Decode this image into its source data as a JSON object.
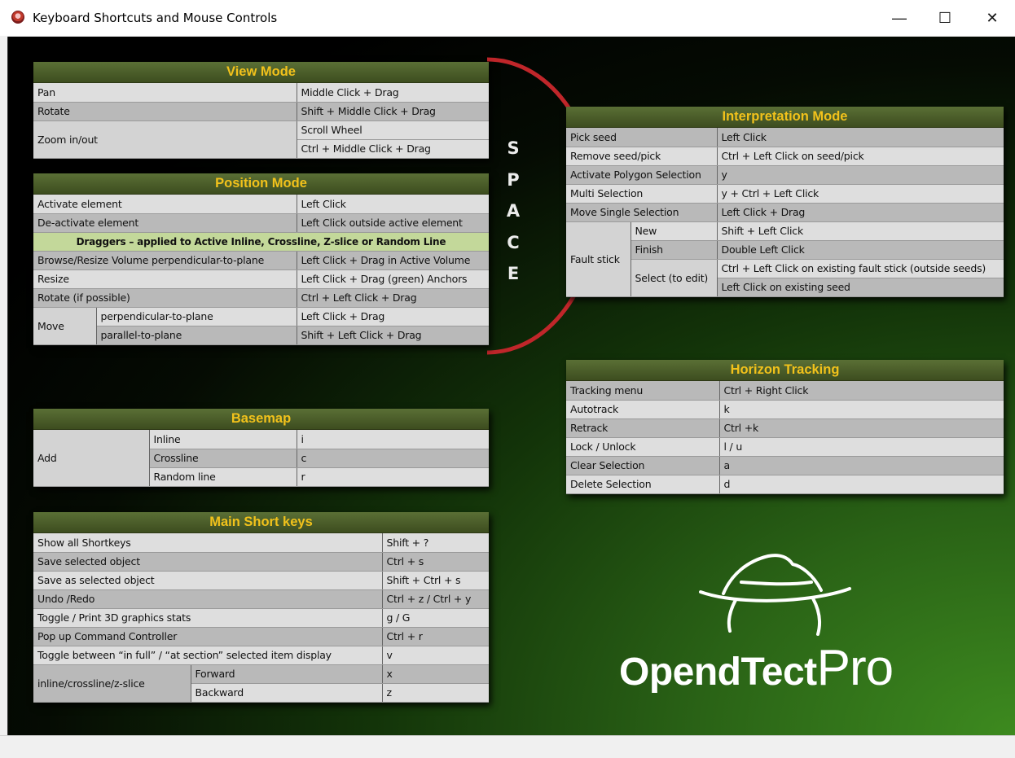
{
  "window": {
    "title": "Keyboard Shortcuts and Mouse Controls",
    "minimize_glyph": "—",
    "maximize_glyph": "☐",
    "close_glyph": "✕"
  },
  "space_label": [
    "S",
    "P",
    "A",
    "C",
    "E"
  ],
  "colors": {
    "header_text": "#f2c21b",
    "header_bg": "#4b5e28",
    "banner_bg": "#c3d89a",
    "arc": "#c0262a"
  },
  "view_mode": {
    "title": "View Mode",
    "rows": [
      {
        "action": "Pan",
        "control": "Middle Click + Drag"
      },
      {
        "action": "Rotate",
        "control": "Shift + Middle Click + Drag"
      },
      {
        "action": "Zoom in/out",
        "control": "Scroll Wheel"
      },
      {
        "control": "Ctrl + Middle Click + Drag"
      }
    ]
  },
  "position_mode": {
    "title": "Position Mode",
    "rows": [
      {
        "action": "Activate element",
        "control": "Left Click"
      },
      {
        "action": "De-activate element",
        "control": "Left Click outside active element"
      }
    ],
    "banner": "Draggers – applied to Active Inline, Crossline, Z-slice or Random Line",
    "dragger_rows": [
      {
        "action": "Browse/Resize Volume perpendicular-to-plane",
        "control": "Left Click + Drag in Active Volume"
      },
      {
        "action": "Resize",
        "control": "Left Click + Drag (green) Anchors"
      },
      {
        "action": "Rotate (if possible)",
        "control": "Ctrl  + Left Click + Drag"
      }
    ],
    "move": {
      "label": "Move",
      "rows": [
        {
          "sub": "perpendicular-to-plane",
          "control": "Left Click + Drag"
        },
        {
          "sub": "parallel-to-plane",
          "control": "Shift + Left Click + Drag"
        }
      ]
    }
  },
  "basemap": {
    "title": "Basemap",
    "add_label": "Add",
    "rows": [
      {
        "sub": "Inline",
        "key": "i"
      },
      {
        "sub": "Crossline",
        "key": "c"
      },
      {
        "sub": "Random line",
        "key": "r"
      }
    ]
  },
  "main_short_keys": {
    "title": "Main Short keys",
    "rows": [
      {
        "action": "Show all Shortkeys",
        "key": "Shift + ?"
      },
      {
        "action": "Save selected object",
        "key": "Ctrl + s"
      },
      {
        "action": "Save as selected object",
        "key": "Shift + Ctrl + s"
      },
      {
        "action": "Undo /Redo",
        "key": "Ctrl + z / Ctrl + y"
      },
      {
        "action": "Toggle / Print 3D graphics stats",
        "key": "g / G"
      },
      {
        "action": "Pop up Command Controller",
        "key": "Ctrl + r"
      },
      {
        "action": "Toggle between  “in full” / “at section” selected item display",
        "key": "v"
      }
    ],
    "slice": {
      "label": "inline/crossline/z-slice",
      "rows": [
        {
          "sub": "Forward",
          "key": "x"
        },
        {
          "sub": "Backward",
          "key": "z"
        }
      ]
    }
  },
  "interpretation_mode": {
    "title": "Interpretation Mode",
    "rows": [
      {
        "action": "Pick seed",
        "control": "Left Click"
      },
      {
        "action": "Remove seed/pick",
        "control": "Ctrl + Left Click on seed/pick"
      },
      {
        "action": "Activate Polygon Selection",
        "control": "y"
      },
      {
        "action": "Multi Selection",
        "control": "y + Ctrl + Left Click"
      },
      {
        "action": "Move Single Selection",
        "control": "Left Click + Drag"
      }
    ],
    "fault_stick": {
      "label": "Fault stick",
      "new": {
        "sub": "New",
        "control": "Shift + Left Click"
      },
      "finish": {
        "sub": "Finish",
        "control": "Double Left Click"
      },
      "select": {
        "sub": "Select (to edit)",
        "controls": [
          "Ctrl + Left Click on existing fault stick (outside seeds)",
          "Left Click on existing seed"
        ]
      }
    }
  },
  "horizon_tracking": {
    "title": "Horizon Tracking",
    "rows": [
      {
        "action": "Tracking menu",
        "control": "Ctrl + Right Click"
      },
      {
        "action": "Autotrack",
        "control": "k"
      },
      {
        "action": "Retrack",
        "control": "Ctrl +k"
      },
      {
        "action": "Lock / Unlock",
        "control": "l / u"
      },
      {
        "action": "Clear Selection",
        "control": "a"
      },
      {
        "action": "Delete Selection",
        "control": "d"
      }
    ]
  },
  "logo": {
    "main": "OpendTect",
    "suffix": "Pro"
  }
}
